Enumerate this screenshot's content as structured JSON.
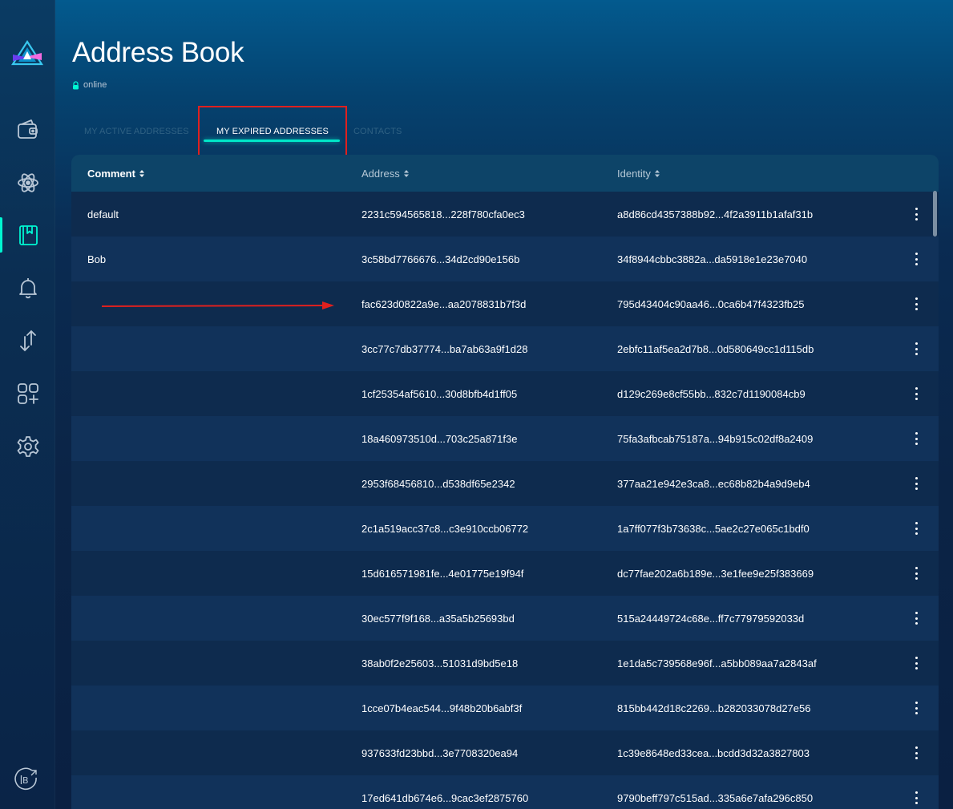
{
  "page": {
    "title": "Address Book",
    "status": "online"
  },
  "colors": {
    "accent": "#00f6d2",
    "highlight": "#e0201e",
    "background": "#0a2344"
  },
  "sidebar": {
    "items": [
      {
        "name": "wallet-icon",
        "active": false
      },
      {
        "name": "atom-icon",
        "active": false
      },
      {
        "name": "address-book-icon",
        "active": true
      },
      {
        "name": "bell-icon",
        "active": false
      },
      {
        "name": "transfer-arrows-icon",
        "active": false
      },
      {
        "name": "apps-icon",
        "active": false
      },
      {
        "name": "settings-icon",
        "active": false
      }
    ],
    "bottom_icon": "beam-explorer-icon"
  },
  "tabs": [
    {
      "label": "MY ACTIVE ADDRESSES",
      "active": false
    },
    {
      "label": "MY EXPIRED ADDRESSES",
      "active": true
    },
    {
      "label": "CONTACTS",
      "active": false
    }
  ],
  "table": {
    "columns": [
      "Comment",
      "Address",
      "Identity"
    ],
    "rows": [
      {
        "comment": "default",
        "address": "2231c594565818...228f780cfa0ec3",
        "identity": "a8d86cd4357388b92...4f2a3911b1afaf31b"
      },
      {
        "comment": "Bob",
        "address": "3c58bd7766676...34d2cd90e156b",
        "identity": "34f8944cbbc3882a...da5918e1e23e7040"
      },
      {
        "comment": "",
        "address": "fac623d0822a9e...aa2078831b7f3d",
        "identity": "795d43404c90aa46...0ca6b47f4323fb25"
      },
      {
        "comment": "",
        "address": "3cc77c7db37774...ba7ab63a9f1d28",
        "identity": "2ebfc11af5ea2d7b8...0d580649cc1d115db"
      },
      {
        "comment": "",
        "address": "1cf25354af5610...30d8bfb4d1ff05",
        "identity": "d129c269e8cf55bb...832c7d1190084cb9"
      },
      {
        "comment": "",
        "address": "18a460973510d...703c25a871f3e",
        "identity": "75fa3afbcab75187a...94b915c02df8a2409"
      },
      {
        "comment": "",
        "address": "2953f68456810...d538df65e2342",
        "identity": "377aa21e942e3ca8...ec68b82b4a9d9eb4"
      },
      {
        "comment": "",
        "address": "2c1a519acc37c8...c3e910ccb06772",
        "identity": "1a7ff077f3b73638c...5ae2c27e065c1bdf0"
      },
      {
        "comment": "",
        "address": "15d616571981fe...4e01775e19f94f",
        "identity": "dc77fae202a6b189e...3e1fee9e25f383669"
      },
      {
        "comment": "",
        "address": "30ec577f9f168...a35a5b25693bd",
        "identity": "515a24449724c68e...ff7c77979592033d"
      },
      {
        "comment": "",
        "address": "38ab0f2e25603...51031d9bd5e18",
        "identity": "1e1da5c739568e96f...a5bb089aa7a2843af"
      },
      {
        "comment": "",
        "address": "1cce07b4eac544...9f48b20b6abf3f",
        "identity": "815bb442d18c2269...b282033078d27e56"
      },
      {
        "comment": "",
        "address": "937633fd23bbd...3e7708320ea94",
        "identity": "1c39e8648ed33cea...bcdd3d32a3827803"
      },
      {
        "comment": "",
        "address": "17ed641db674e6...9cac3ef2875760",
        "identity": "9790beff797c515ad...335a6e7afa296c850"
      }
    ]
  }
}
